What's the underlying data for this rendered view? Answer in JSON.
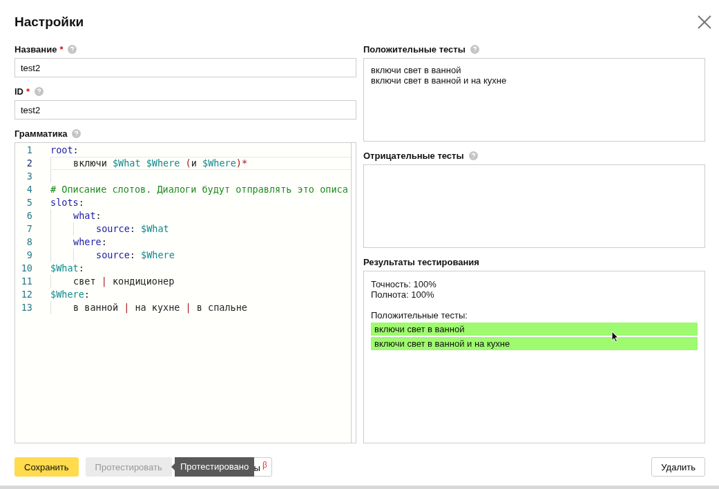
{
  "dialog": {
    "title": "Настройки"
  },
  "fields": [
    {
      "label": "Название",
      "required_mark": "*",
      "value": "test2"
    },
    {
      "label": "ID",
      "required_mark": "*",
      "value": "test2"
    }
  ],
  "grammar": {
    "label": "Грамматика",
    "lines": [
      {
        "number": "1",
        "current": false,
        "tokens": [
          {
            "kind": "keyword",
            "text": "root"
          },
          {
            "kind": "plain",
            "text": ":"
          }
        ],
        "children": [
          {
            "number": "2",
            "current": true,
            "tokens": [
              {
                "kind": "plain",
                "text": "включи "
              },
              {
                "kind": "variable",
                "text": "$What "
              },
              {
                "kind": "variable",
                "text": "$Where "
              },
              {
                "kind": "operator",
                "text": "("
              },
              {
                "kind": "plain",
                "text": "и "
              },
              {
                "kind": "variable",
                "text": "$Where"
              },
              {
                "kind": "operator",
                "text": ")*"
              }
            ]
          },
          {
            "number": "3",
            "current": false
          }
        ]
      },
      {
        "number": "4",
        "current": false,
        "tokens": [
          {
            "kind": "comment",
            "text": "# Описание слотов. Диалоги будут отправлять это описа"
          }
        ]
      },
      {
        "number": "5",
        "current": false,
        "tokens": [
          {
            "kind": "keyword",
            "text": "slots"
          },
          {
            "kind": "plain",
            "text": ":"
          }
        ],
        "children": [
          {
            "number": "6",
            "current": false,
            "tokens": [
              {
                "kind": "keyword",
                "text": "what"
              },
              {
                "kind": "plain",
                "text": ":"
              }
            ],
            "children": [
              {
                "number": "7",
                "current": false,
                "tokens": [
                  {
                    "kind": "keyword",
                    "text": "source"
                  },
                  {
                    "kind": "plain",
                    "text": ": "
                  },
                  {
                    "kind": "variable",
                    "text": "$What"
                  }
                ]
              }
            ]
          },
          {
            "number": "8",
            "current": false,
            "tokens": [
              {
                "kind": "keyword",
                "text": "where"
              },
              {
                "kind": "plain",
                "text": ":"
              }
            ],
            "children": [
              {
                "number": "9",
                "current": false,
                "tokens": [
                  {
                    "kind": "keyword",
                    "text": "source"
                  },
                  {
                    "kind": "plain",
                    "text": ": "
                  },
                  {
                    "kind": "variable",
                    "text": "$Where"
                  }
                ]
              }
            ]
          }
        ]
      },
      {
        "number": "10",
        "current": false,
        "tokens": [
          {
            "kind": "variable",
            "text": "$What"
          },
          {
            "kind": "plain",
            "text": ":"
          }
        ],
        "children": [
          {
            "number": "11",
            "current": false,
            "tokens": [
              {
                "kind": "plain",
                "text": "свет "
              },
              {
                "kind": "operator",
                "text": "|"
              },
              {
                "kind": "plain",
                "text": " кондиционер"
              }
            ]
          }
        ]
      },
      {
        "number": "12",
        "current": false,
        "tokens": [
          {
            "kind": "variable",
            "text": "$Where"
          },
          {
            "kind": "plain",
            "text": ":"
          }
        ],
        "children": [
          {
            "number": "13",
            "current": false,
            "tokens": [
              {
                "kind": "plain",
                "text": "в ванной "
              },
              {
                "kind": "operator",
                "text": "|"
              },
              {
                "kind": "plain",
                "text": " на кухне "
              },
              {
                "kind": "operator",
                "text": "|"
              },
              {
                "kind": "plain",
                "text": " в спальне"
              }
            ]
          }
        ]
      }
    ]
  },
  "positive_tests": {
    "label": "Положительные тесты",
    "lines": [
      "включи свет в ванной",
      "включи свет в ванной и на кухне"
    ]
  },
  "negative_tests": {
    "label": "Отрицательные тесты"
  },
  "results": {
    "label": "Результаты тестирования",
    "metrics": [
      "Точность: 100%",
      "Полнота: 100%"
    ],
    "section": "Положительные тесты:",
    "items": [
      {
        "text": "включи свет в ванной",
        "passed": true
      },
      {
        "text": "включи свет в ванной и на кухне",
        "passed": true
      }
    ]
  },
  "buttons": [
    {
      "kind": "primary",
      "label": "Сохранить"
    },
    {
      "kind": "secondary",
      "label": "Протестировать",
      "disabled": true
    },
    {
      "kind": "covered",
      "label": "ы",
      "badge": "β"
    }
  ],
  "tooltip": "Протестировано",
  "delete_button": "Удалить"
}
